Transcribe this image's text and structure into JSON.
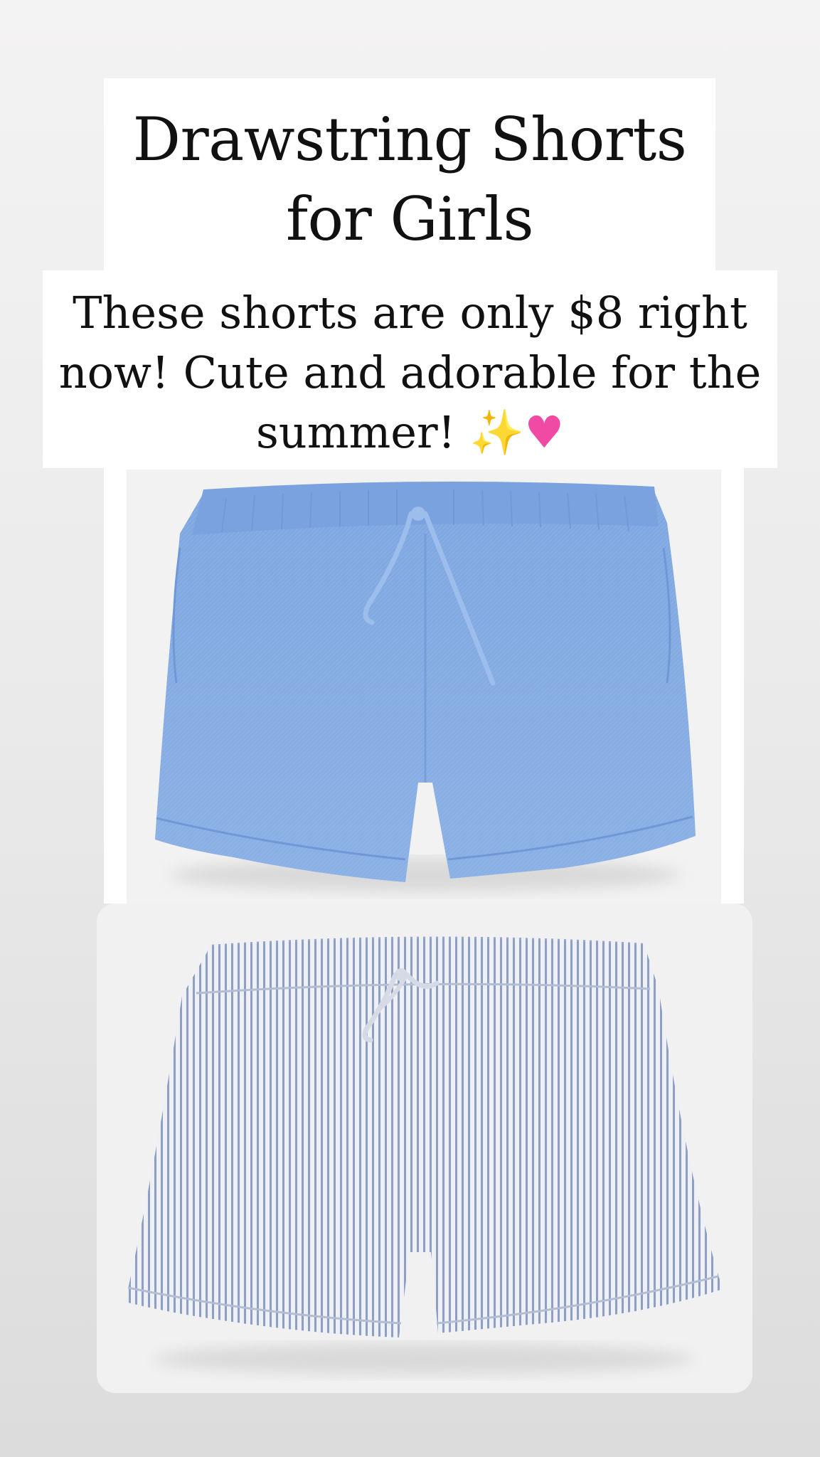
{
  "story": {
    "title_line1": "Drawstring Shorts",
    "title_line2": "for Girls",
    "caption_line1": "These shorts are only $8 right",
    "caption_line2": "now! Cute and adorable for the",
    "caption_line3": "summer!",
    "caption_emoji_sparkles": "✨",
    "caption_emoji_heart": "♥"
  },
  "products": [
    {
      "name": "chambray-drawstring-shorts",
      "color": "#8fb3e6"
    },
    {
      "name": "striped-linen-drawstring-shorts",
      "color": "#c9d2e4"
    }
  ],
  "colors": {
    "background": "#ececec",
    "panel": "#ffffff",
    "text": "#111111",
    "sparkle": "#f2b31a",
    "heart": "#f04aa4"
  },
  "icons": [
    "sparkles-icon",
    "pink-heart-icon"
  ]
}
